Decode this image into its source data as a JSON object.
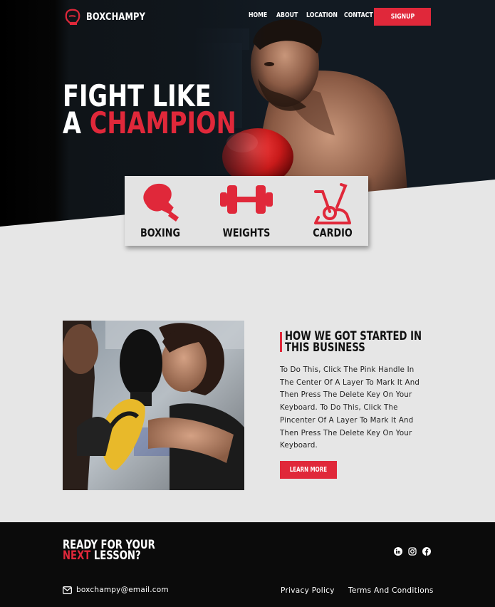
{
  "brand": {
    "name": "BOXCHAMPY",
    "logo_icon": "boxing-glove-icon"
  },
  "nav": {
    "items": [
      {
        "label": "HOME"
      },
      {
        "label": "ABOUT"
      },
      {
        "label": "LOCATION"
      },
      {
        "label": "CONTACT"
      }
    ],
    "signup_label": "SIGNUP"
  },
  "hero": {
    "headline_line1": "FIGHT LIKE",
    "headline_line2_prefix": "A ",
    "headline_line2_accent": "CHAMPION",
    "image": "boxer-with-red-gloves-photo"
  },
  "features": [
    {
      "label": "BOXING",
      "icon": "boxing-glove-icon"
    },
    {
      "label": "WEIGHTS",
      "icon": "dumbbell-icon"
    },
    {
      "label": "CARDIO",
      "icon": "exercise-bike-icon"
    }
  ],
  "about": {
    "title_line1": "HOW WE GOT STARTED IN",
    "title_line2": "THIS BUSINESS",
    "body": "To Do This, Click The Pink Handle In The Center Of A Layer To Mark It And Then Press The Delete Key On Your Keyboard. To Do This, Click The Pincenter Of A Layer To Mark It And Then Press The Delete Key On Your Keyboard.",
    "button_label": "LEARN MORE",
    "image": "woman-boxing-training-photo"
  },
  "footer": {
    "cta_line1": "READY FOR YOUR",
    "cta_line2_accent": "NEXT",
    "cta_line2_rest": " LESSON?",
    "socials": [
      "linkedin-icon",
      "instagram-icon",
      "facebook-icon"
    ],
    "email": "boxchampy@email.com",
    "privacy_label": "Privacy Policy",
    "terms_label": "Terms And Conditions"
  },
  "colors": {
    "accent": "#e0283a",
    "dark": "#0b0b0b",
    "light": "#e6e6e6"
  }
}
